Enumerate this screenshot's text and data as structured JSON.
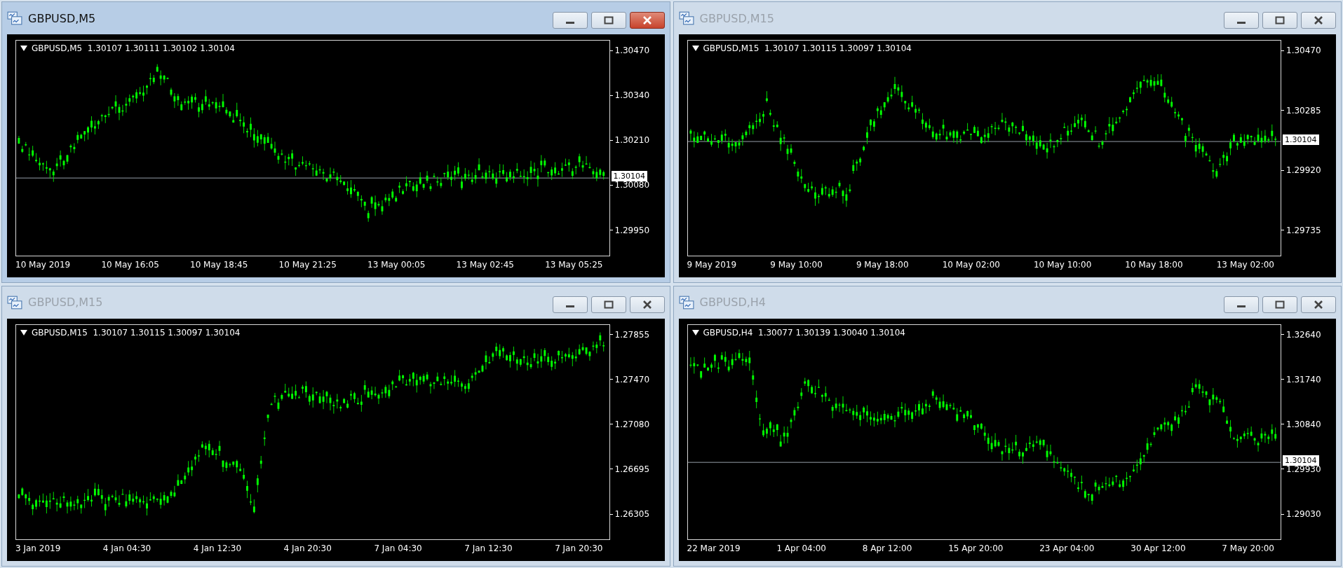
{
  "windows": [
    {
      "title": "GBPUSD,M5",
      "active": true,
      "header": "GBPUSD,M5  1.30107 1.30111 1.30102 1.30104",
      "price_labels": [
        "1.30470",
        "1.30340",
        "1.30210",
        "1.30080",
        "1.29950"
      ],
      "time_labels": [
        "10 May 2019",
        "10 May 16:05",
        "10 May 18:45",
        "10 May 21:25",
        "13 May 00:05",
        "13 May 02:45",
        "13 May 05:25"
      ],
      "bid": {
        "label": "1.30104"
      }
    },
    {
      "title": "GBPUSD,M15",
      "active": false,
      "header": "GBPUSD,M15  1.30107 1.30115 1.30097 1.30104",
      "price_labels": [
        "1.30470",
        "1.30285",
        "1.29920",
        "1.29735"
      ],
      "time_labels": [
        "9 May 2019",
        "9 May 10:00",
        "9 May 18:00",
        "10 May 02:00",
        "10 May 10:00",
        "10 May 18:00",
        "13 May 02:00"
      ],
      "bid": {
        "label": "1.30104"
      }
    },
    {
      "title": "GBPUSD,M15",
      "active": false,
      "header": "GBPUSD,M15  1.30107 1.30115 1.30097 1.30104",
      "price_labels": [
        "1.27855",
        "1.27470",
        "1.27080",
        "1.26695",
        "1.26305"
      ],
      "time_labels": [
        "3 Jan 2019",
        "4 Jan 04:30",
        "4 Jan 12:30",
        "4 Jan 20:30",
        "7 Jan 04:30",
        "7 Jan 12:30",
        "7 Jan 20:30"
      ]
    },
    {
      "title": "GBPUSD,H4",
      "active": false,
      "header": "GBPUSD,H4  1.30077 1.30139 1.30040 1.30104",
      "price_labels": [
        "1.32640",
        "1.31740",
        "1.30840",
        "1.29930",
        "1.29030"
      ],
      "time_labels": [
        "22 Mar 2019",
        "1 Apr 04:00",
        "8 Apr 12:00",
        "15 Apr 20:00",
        "23 Apr 04:00",
        "30 Apr 12:00",
        "7 May 20:00"
      ],
      "bid": {
        "label": "1.30104"
      }
    }
  ]
}
